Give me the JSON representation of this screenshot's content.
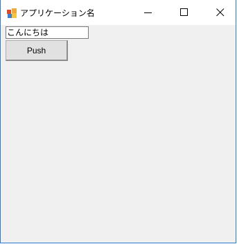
{
  "window": {
    "title": "アプリケーション名",
    "controls": {
      "minimize_icon": "minimize-icon",
      "maximize_icon": "maximize-icon",
      "close_icon": "close-icon"
    },
    "border_color": "#2b7bd1"
  },
  "form": {
    "textbox": {
      "value": "こんにちは"
    },
    "button": {
      "label": "Push"
    }
  }
}
